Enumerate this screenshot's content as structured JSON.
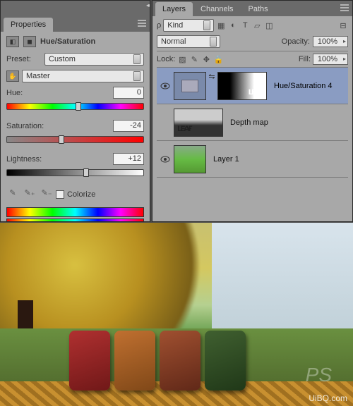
{
  "properties": {
    "tab": "Properties",
    "title": "Hue/Saturation",
    "preset_label": "Preset:",
    "preset_value": "Custom",
    "channel_value": "Master",
    "hue_label": "Hue:",
    "hue_value": "0",
    "sat_label": "Saturation:",
    "sat_value": "-24",
    "lig_label": "Lightness:",
    "lig_value": "+12",
    "colorize_label": "Colorize"
  },
  "layers": {
    "tabs": [
      "Layers",
      "Channels",
      "Paths"
    ],
    "filter_value": "Kind",
    "blend_value": "Normal",
    "opacity_label": "Opacity:",
    "opacity_value": "100%",
    "lock_label": "Lock:",
    "fill_label": "Fill:",
    "fill_value": "100%",
    "items": [
      {
        "name": "Hue/Saturation 4",
        "visible": true,
        "selected": true,
        "mask": true,
        "adj": true
      },
      {
        "name": "Depth map",
        "visible": false,
        "selected": false,
        "mask": false,
        "depth": true
      },
      {
        "name": "Layer 1",
        "visible": true,
        "selected": false,
        "mask": false,
        "scene": true
      }
    ]
  },
  "watermark": "UiBQ.com",
  "watermark2": "PS"
}
